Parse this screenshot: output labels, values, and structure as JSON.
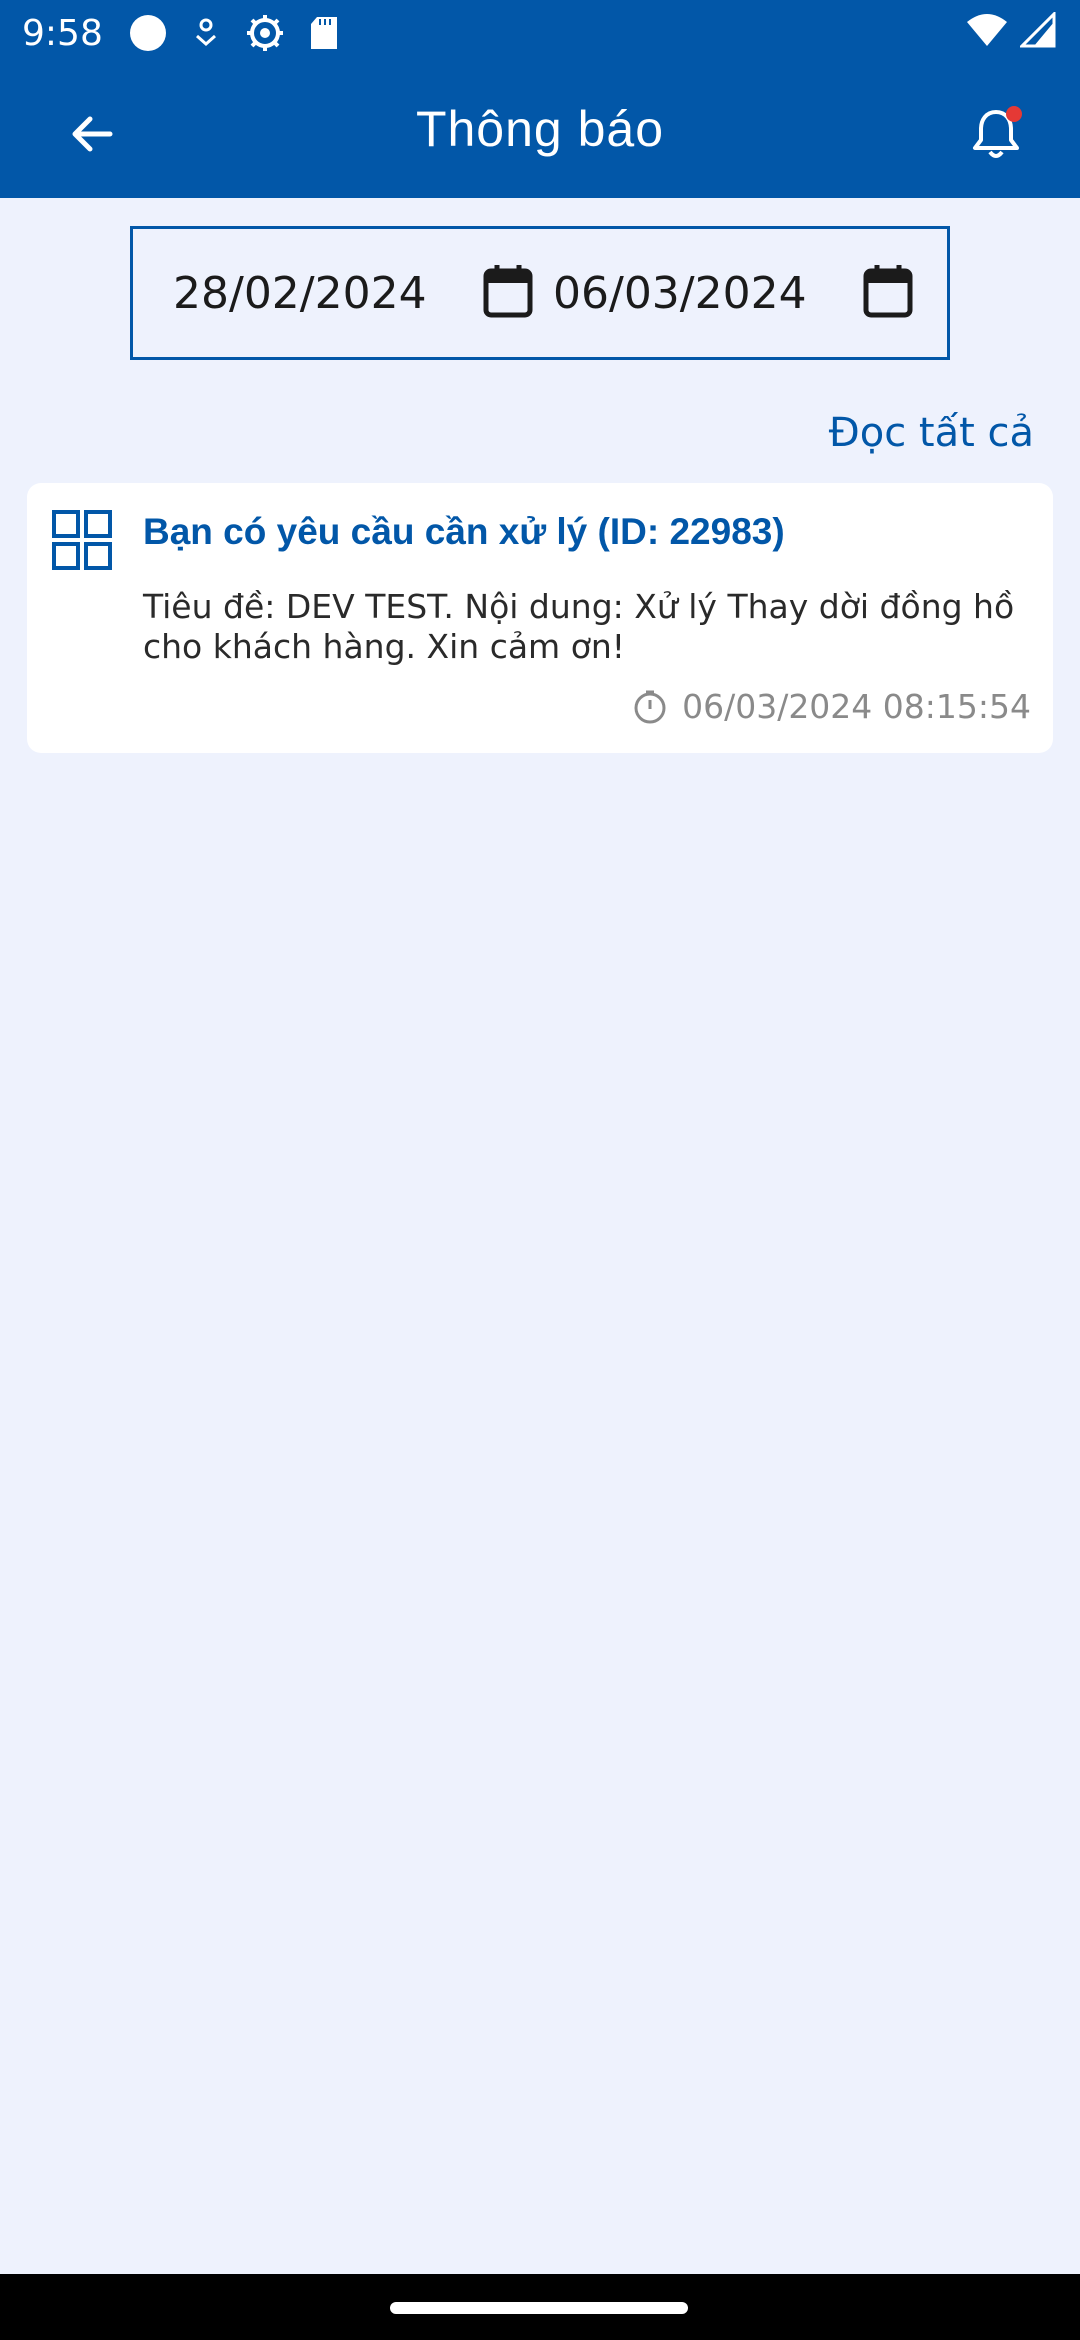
{
  "status_bar": {
    "time": "9:58",
    "icons": [
      "circle-icon",
      "location-download-icon",
      "settings-icon",
      "sd-card-icon",
      "wifi-icon",
      "signal-icon"
    ]
  },
  "app_bar": {
    "title": "Thông báo",
    "back_icon": "arrow-left-icon",
    "notification_icon": "bell-icon",
    "has_unread_dot": true
  },
  "date_range": {
    "from": "28/02/2024",
    "to": "06/03/2024"
  },
  "actions": {
    "read_all": "Đọc tất cả"
  },
  "notifications": [
    {
      "title": "Bạn có yêu cầu cần xử lý (ID: 22983)",
      "body": "Tiêu đề: DEV TEST. Nội dung: Xử lý Thay dời đồng hồ cho khách hàng. Xin cảm ơn!",
      "timestamp": "06/03/2024 08:15:54"
    }
  ],
  "colors": {
    "primary": "#0257a8",
    "background": "#eef2fd",
    "card": "#ffffff",
    "muted": "#8a8a8a",
    "badge": "#e53935"
  }
}
